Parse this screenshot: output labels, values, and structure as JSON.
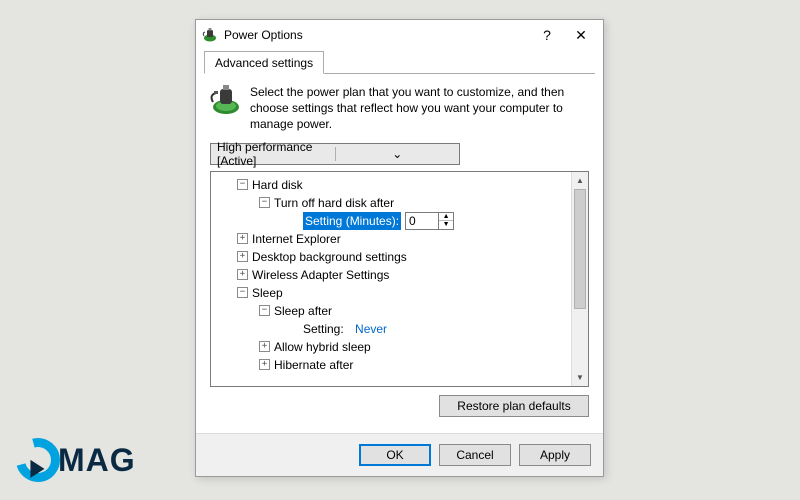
{
  "titlebar": {
    "title": "Power Options",
    "help": "?",
    "close": "✕"
  },
  "tab": {
    "label": "Advanced settings"
  },
  "intro": "Select the power plan that you want to customize, and then choose settings that reflect how you want your computer to manage power.",
  "plan_dropdown": {
    "selected": "High performance [Active]"
  },
  "tree": {
    "hard_disk": {
      "label": "Hard disk",
      "turn_off": {
        "label": "Turn off hard disk after",
        "setting_label": "Setting (Minutes):",
        "value": "0"
      }
    },
    "ie": {
      "label": "Internet Explorer"
    },
    "desktop_bg": {
      "label": "Desktop background settings"
    },
    "wireless": {
      "label": "Wireless Adapter Settings"
    },
    "sleep": {
      "label": "Sleep",
      "sleep_after": {
        "label": "Sleep after",
        "setting_label": "Setting:",
        "value": "Never"
      },
      "hybrid": {
        "label": "Allow hybrid sleep"
      },
      "hibernate": {
        "label": "Hibernate after"
      }
    }
  },
  "buttons": {
    "restore": "Restore plan defaults",
    "ok": "OK",
    "cancel": "Cancel",
    "apply": "Apply"
  },
  "logo": {
    "text": "MAG"
  }
}
